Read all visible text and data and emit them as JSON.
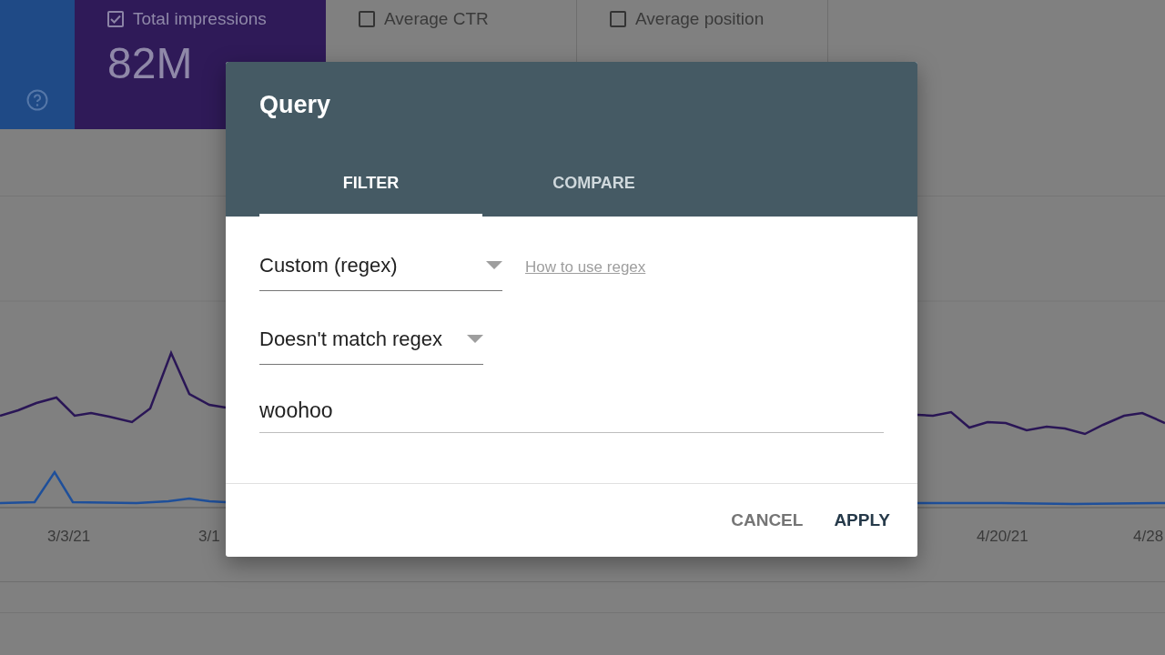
{
  "metric_cards": [
    {
      "label": "Total impressions",
      "value": "82M",
      "checked": true
    },
    {
      "label": "Average CTR",
      "checked": false
    },
    {
      "label": "Average position",
      "checked": false
    }
  ],
  "chart": {
    "x_labels": [
      "3/3/21",
      "3/1",
      "4/20/21",
      "4/28"
    ]
  },
  "dialog": {
    "title": "Query",
    "tabs": [
      {
        "label": "FILTER",
        "selected": true
      },
      {
        "label": "COMPARE",
        "selected": false
      }
    ],
    "filter_type": {
      "value": "Custom (regex)"
    },
    "help_link": "How to use regex",
    "match_type": {
      "value": "Doesn't match regex"
    },
    "expression": {
      "value": "woohoo"
    },
    "buttons": [
      {
        "label": "CANCEL",
        "kind": "secondary"
      },
      {
        "label": "APPLY",
        "kind": "primary"
      }
    ]
  }
}
